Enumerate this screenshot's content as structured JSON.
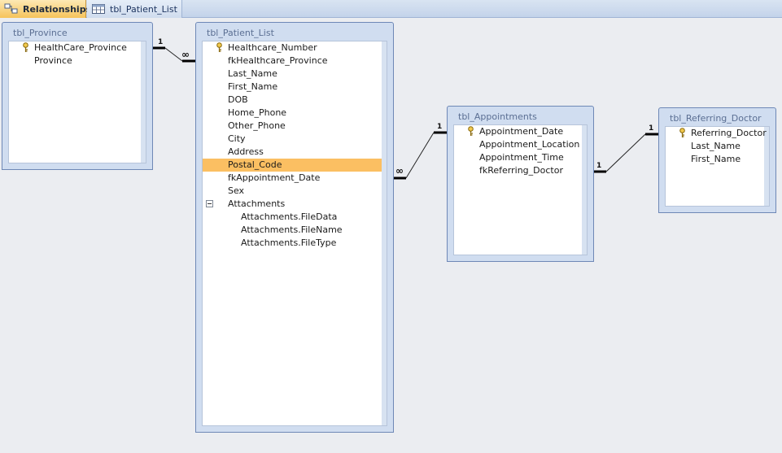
{
  "tabs": [
    {
      "label": "Relationships",
      "active": true,
      "icon": "relationships-icon"
    },
    {
      "label": "tbl_Patient_List",
      "active": false,
      "icon": "table-icon"
    }
  ],
  "tables": {
    "province": {
      "title": "tbl_Province",
      "fields": [
        "HealthCare_Province",
        "Province"
      ],
      "key_fields": [
        "HealthCare_Province"
      ]
    },
    "patient": {
      "title": "tbl_Patient_List",
      "fields": [
        "Healthcare_Number",
        "fkHealthcare_Province",
        "Last_Name",
        "First_Name",
        "DOB",
        "Home_Phone",
        "Other_Phone",
        "City",
        "Address",
        "Postal_Code",
        "fkAppointment_Date",
        "Sex",
        "Attachments"
      ],
      "attachment_subfields": [
        "Attachments.FileData",
        "Attachments.FileName",
        "Attachments.FileType"
      ],
      "key_fields": [
        "Healthcare_Number"
      ],
      "selected_field": "Postal_Code"
    },
    "appointments": {
      "title": "tbl_Appointments",
      "fields": [
        "Appointment_Date",
        "Appointment_Location",
        "Appointment_Time",
        "fkReferring_Doctor"
      ],
      "key_fields": [
        "Appointment_Date"
      ]
    },
    "referring": {
      "title": "tbl_Referring_Doctor",
      "fields": [
        "Referring_Doctor",
        "Last_Name",
        "First_Name"
      ],
      "key_fields": [
        "Referring_Doctor"
      ]
    }
  },
  "relationships": [
    {
      "from": "tbl_Province",
      "to": "tbl_Patient_List",
      "from_card": "1",
      "to_card": "∞"
    },
    {
      "from": "tbl_Patient_List",
      "to": "tbl_Appointments",
      "from_card": "∞",
      "to_card": "1"
    },
    {
      "from": "tbl_Appointments",
      "to": "tbl_Referring_Doctor",
      "from_card": "1",
      "to_card": "1"
    }
  ],
  "colors": {
    "window_frame": "#d0ddf0",
    "window_border": "#6e88b6",
    "selection": "#fbbf62",
    "active_tab": "#f6c35b",
    "canvas": "#ebedf1"
  }
}
